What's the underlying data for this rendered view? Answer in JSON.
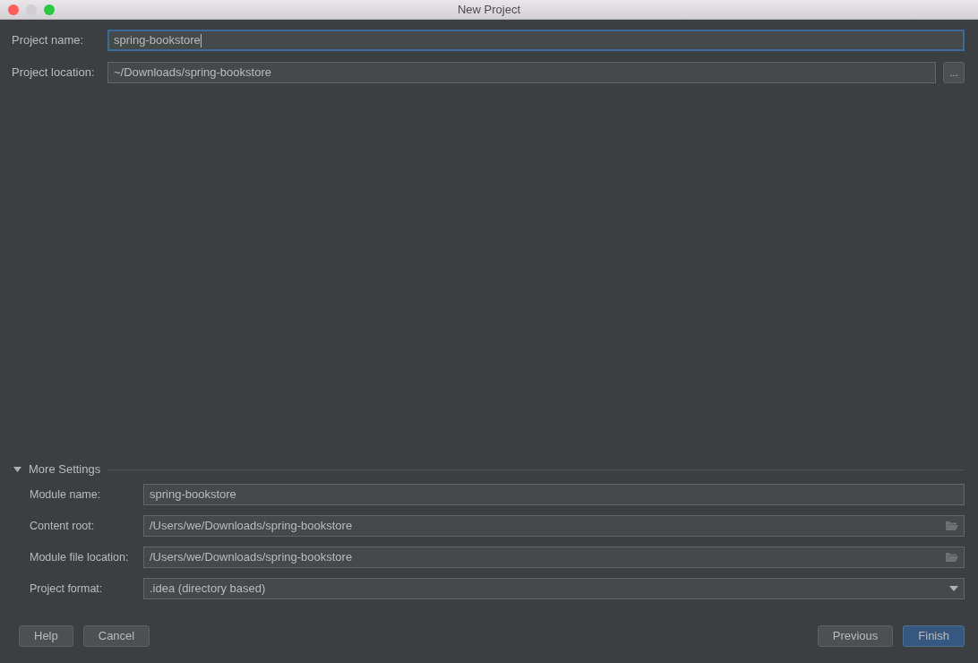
{
  "window": {
    "title": "New Project"
  },
  "top_fields": [
    {
      "label": "Project name:",
      "value": "spring-bookstore",
      "focused": true,
      "kind": "text"
    },
    {
      "label": "Project location:",
      "value": "~/Downloads/spring-bookstore",
      "focused": false,
      "kind": "browse",
      "button": "..."
    }
  ],
  "more_settings": {
    "title": "More Settings",
    "expanded": true,
    "fields": [
      {
        "label": "Module name:",
        "value": "spring-bookstore",
        "kind": "text"
      },
      {
        "label": "Content root:",
        "value": "/Users/we/Downloads/spring-bookstore",
        "kind": "folder"
      },
      {
        "label": "Module file location:",
        "value": "/Users/we/Downloads/spring-bookstore",
        "kind": "folder"
      },
      {
        "label": "Project format:",
        "value": ".idea (directory based)",
        "kind": "dropdown"
      }
    ]
  },
  "buttons_left": [
    {
      "label": "Help",
      "primary": false
    },
    {
      "label": "Cancel",
      "primary": false
    }
  ],
  "buttons_right": [
    {
      "label": "Previous",
      "primary": false
    },
    {
      "label": "Finish",
      "primary": true
    }
  ]
}
